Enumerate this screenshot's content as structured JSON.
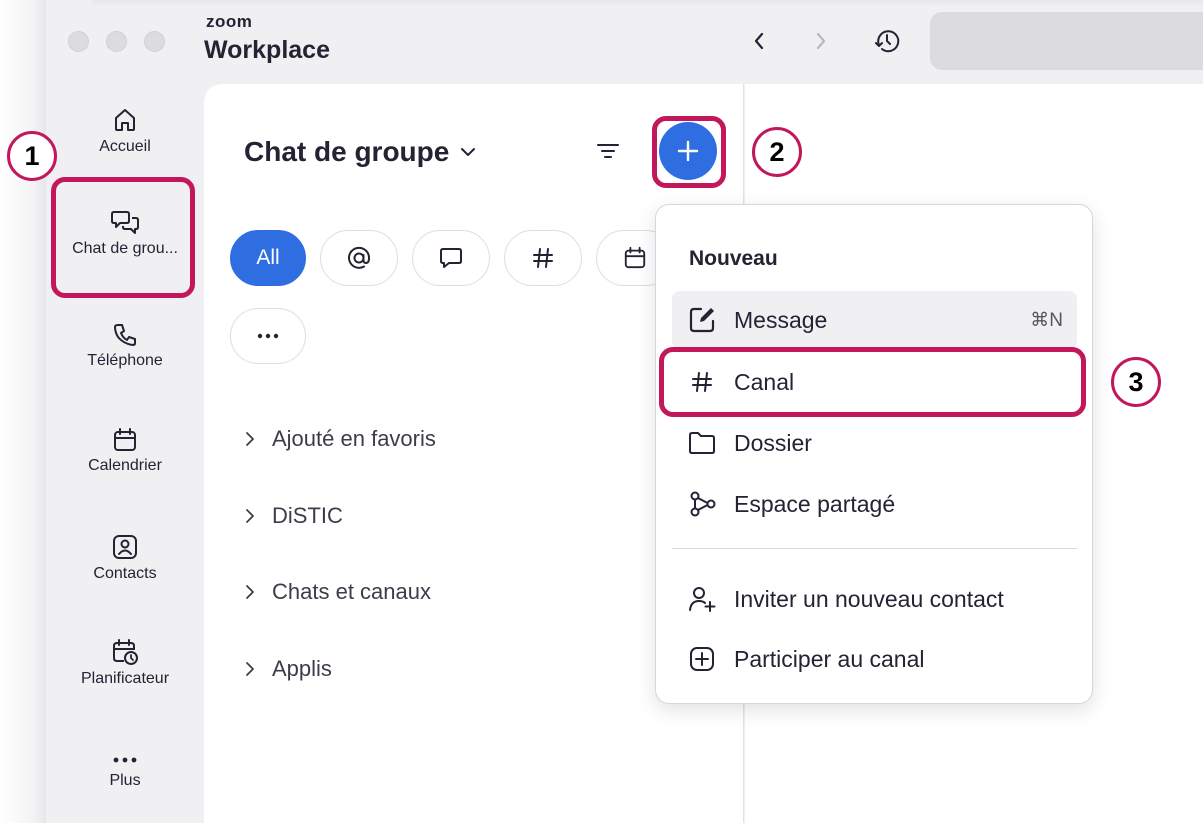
{
  "window": {
    "brand_small": "zoom",
    "brand_big": "Workplace"
  },
  "sidebar": {
    "items": [
      {
        "label": "Accueil",
        "icon": "home-icon"
      },
      {
        "label": "Chat de grou...",
        "icon": "chat-bubbles-icon"
      },
      {
        "label": "Téléphone",
        "icon": "phone-icon"
      },
      {
        "label": "Calendrier",
        "icon": "calendar-icon"
      },
      {
        "label": "Contacts",
        "icon": "contact-card-icon"
      },
      {
        "label": "Planificateur",
        "icon": "scheduler-icon"
      },
      {
        "label": "Plus",
        "icon": "more-dots-icon"
      }
    ]
  },
  "panel": {
    "title": "Chat de groupe",
    "filters": [
      {
        "label": "All",
        "active": true
      },
      {
        "icon": "at-icon"
      },
      {
        "icon": "chat-bubble-icon"
      },
      {
        "icon": "hash-icon"
      },
      {
        "icon": "calendar-icon"
      },
      {
        "icon": "more-dots-icon"
      }
    ],
    "sections": [
      {
        "label": "Ajouté en favoris"
      },
      {
        "label": "DiSTIC"
      },
      {
        "label": "Chats et canaux"
      },
      {
        "label": "Applis"
      }
    ]
  },
  "menu": {
    "title": "Nouveau",
    "items": [
      {
        "label": "Message",
        "icon": "compose-icon",
        "shortcut": "⌘N"
      },
      {
        "label": "Canal",
        "icon": "hash-icon"
      },
      {
        "label": "Dossier",
        "icon": "folder-icon"
      },
      {
        "label": "Espace partagé",
        "icon": "shared-space-icon"
      },
      {
        "label": "Inviter un nouveau contact",
        "icon": "add-person-icon"
      },
      {
        "label": "Participer au canal",
        "icon": "plus-square-icon"
      }
    ]
  },
  "annotations": [
    "1",
    "2",
    "3"
  ],
  "colors": {
    "accent": "#2f6ee0",
    "annotation": "#c2185b"
  }
}
